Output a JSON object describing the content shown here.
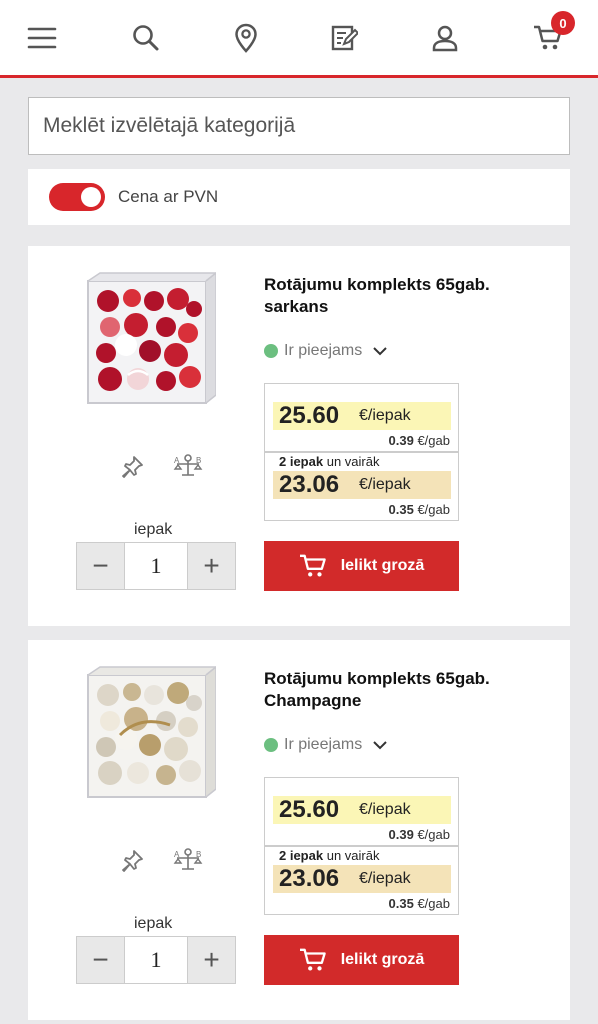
{
  "header": {
    "icons": [
      "menu-icon",
      "search-icon",
      "location-pin-icon",
      "order-list-icon",
      "user-icon",
      "cart-icon"
    ],
    "cart_count": "0",
    "accent": "#d8262b"
  },
  "search": {
    "placeholder": "Meklēt izvēlētajā kategorijā"
  },
  "vat_toggle": {
    "label": "Cena ar PVN",
    "on": true
  },
  "products": [
    {
      "title": "Rotājumu komplekts 65gab. sarkans",
      "availability": "Ir pieejams",
      "price_main": "25.60",
      "price_main_unit": "€/iepak",
      "price_main_per": "0.39",
      "price_main_per_unit": "€/gab",
      "tier_qty": "2 iepak",
      "tier_text": "un vairāk",
      "price_tier": "23.06",
      "price_tier_unit": "€/iepak",
      "price_tier_per": "0.35",
      "price_tier_per_unit": "€/gab",
      "unit_label": "iepak",
      "quantity": "1",
      "add_label": "Ielikt grozā",
      "image_color": "red"
    },
    {
      "title": "Rotājumu komplekts 65gab. Champagne",
      "availability": "Ir pieejams",
      "price_main": "25.60",
      "price_main_unit": "€/iepak",
      "price_main_per": "0.39",
      "price_main_per_unit": "€/gab",
      "tier_qty": "2 iepak",
      "tier_text": "un vairāk",
      "price_tier": "23.06",
      "price_tier_unit": "€/iepak",
      "price_tier_per": "0.35",
      "price_tier_per_unit": "€/gab",
      "unit_label": "iepak",
      "quantity": "1",
      "add_label": "Ielikt grozā",
      "image_color": "champagne"
    }
  ]
}
